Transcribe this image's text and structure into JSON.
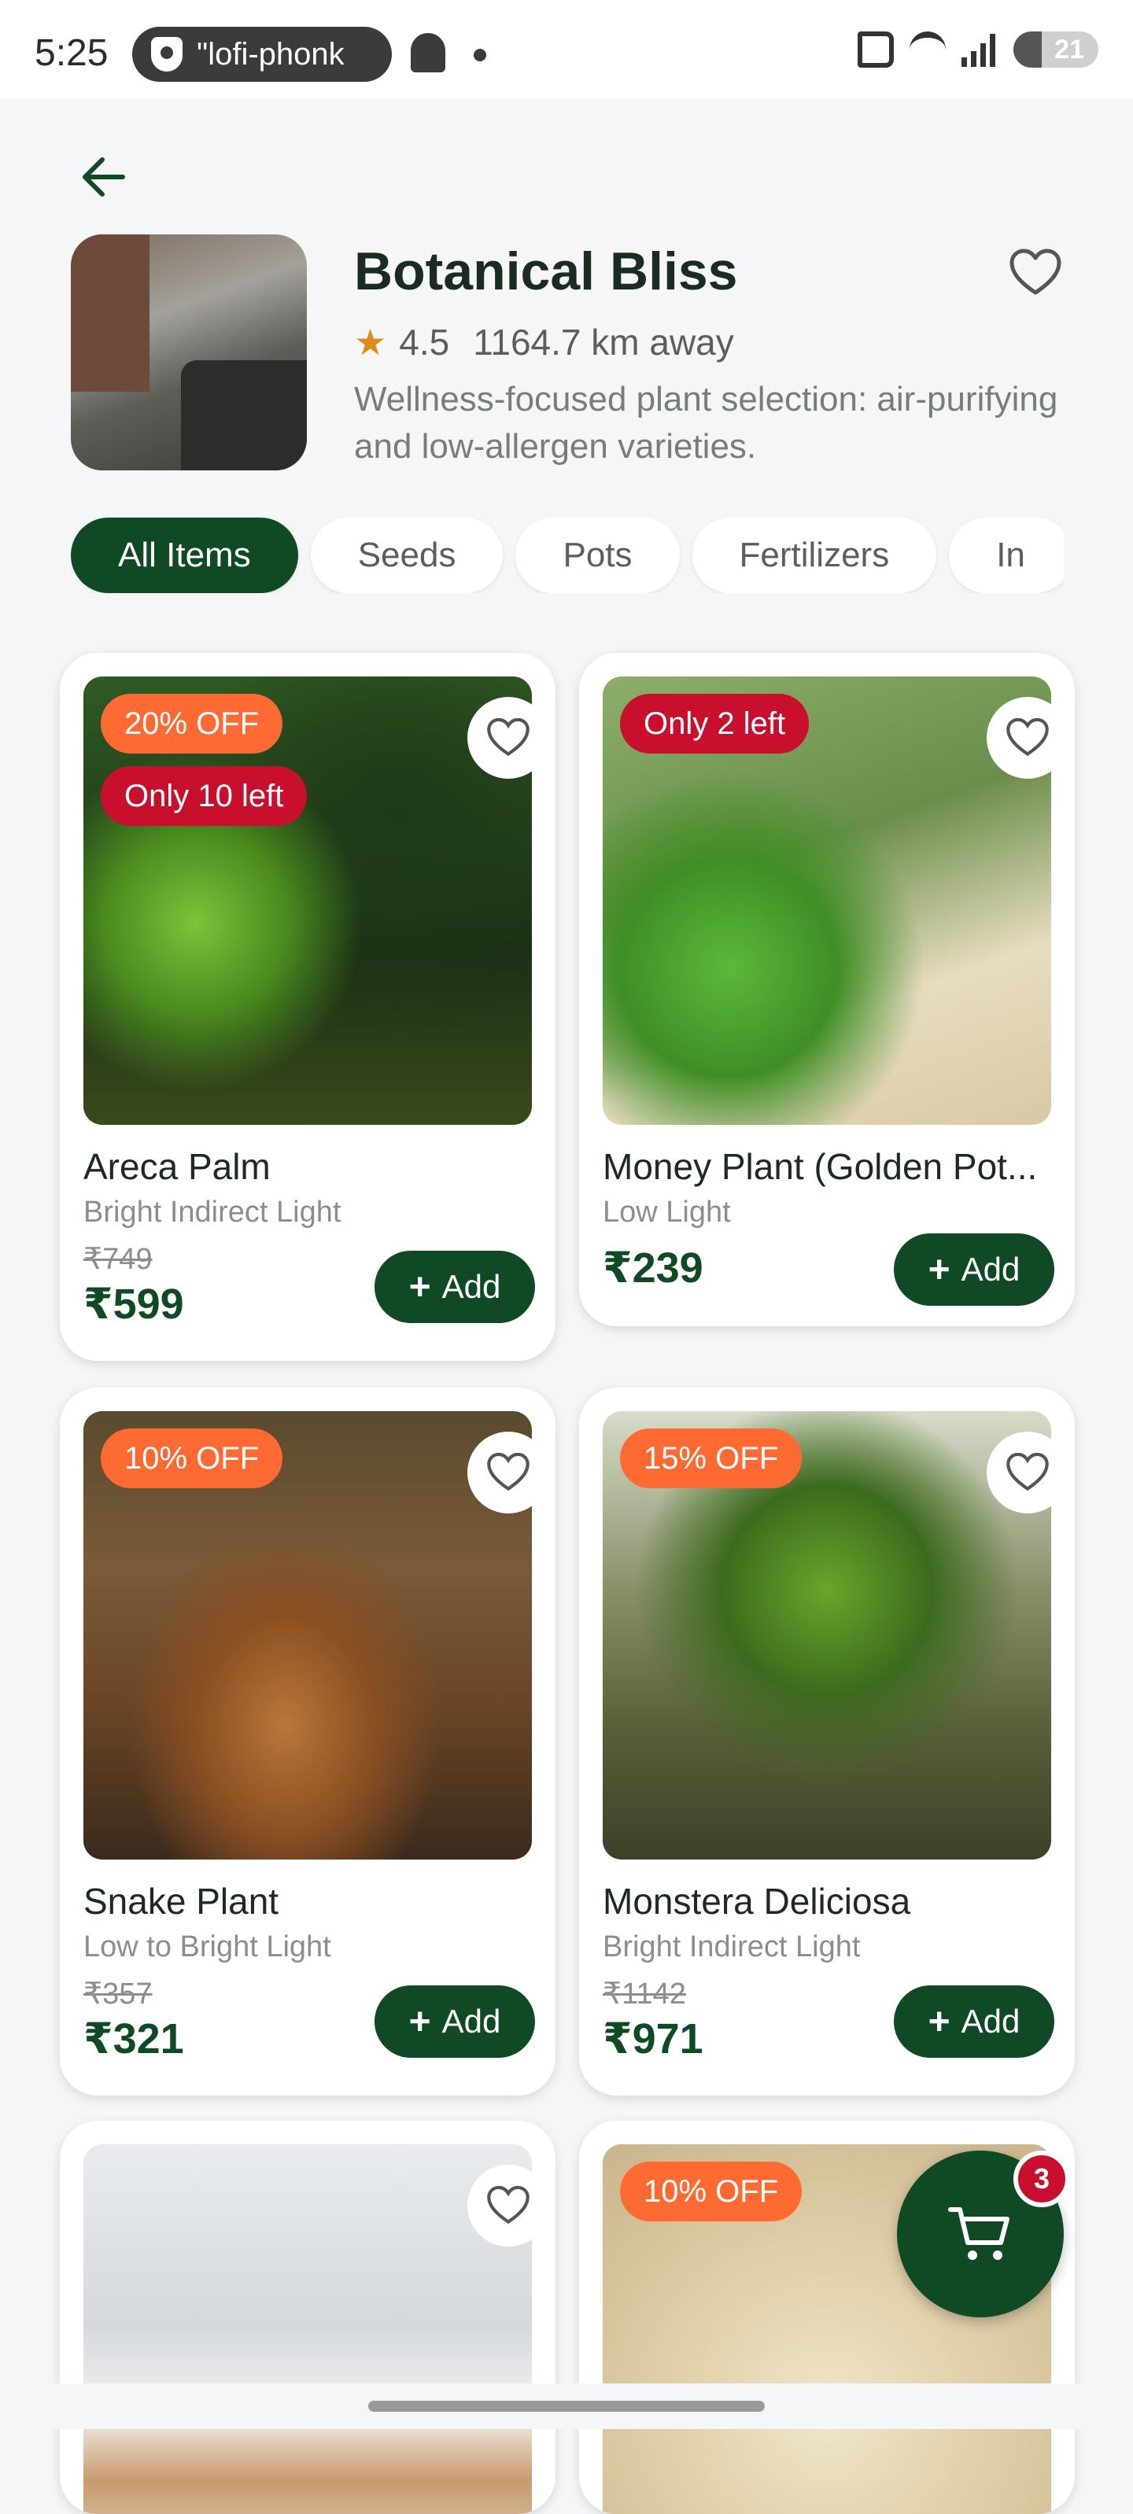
{
  "status_bar": {
    "time": "5:25",
    "media_pill": "\"lofi-phonk",
    "battery": "21"
  },
  "header": {
    "back_icon": "arrow-left-icon",
    "store_name": "Botanical Bliss",
    "rating": "4.5",
    "distance": "1164.7 km away",
    "description": "Wellness-focused plant selection: air-purifying and low-allergen varieties.",
    "favorite_icon": "heart-outline-icon"
  },
  "categories": [
    "All Items",
    "Seeds",
    "Pots",
    "Fertilizers",
    "In"
  ],
  "products": [
    {
      "name": "Areca Palm",
      "light": "Bright Indirect Light",
      "original_price": "₹749",
      "price": "₹599",
      "discount": "20% OFF",
      "stock": "Only 10 left",
      "add_label": "Add"
    },
    {
      "name": "Money Plant (Golden Pot...",
      "light": "Low Light",
      "original_price": "",
      "price": "₹239",
      "discount": "",
      "stock": "Only 2 left",
      "add_label": "Add"
    },
    {
      "name": "Snake Plant",
      "light": "Low to Bright Light",
      "original_price": "₹357",
      "price": "₹321",
      "discount": "10% OFF",
      "stock": "",
      "add_label": "Add"
    },
    {
      "name": "Monstera Deliciosa",
      "light": "Bright Indirect Light",
      "original_price": "₹1142",
      "price": "₹971",
      "discount": "15% OFF",
      "stock": "",
      "add_label": "Add"
    },
    {
      "discount": ""
    },
    {
      "discount": "10% OFF"
    }
  ],
  "cart": {
    "count": "3",
    "icon": "cart-icon"
  },
  "colors": {
    "primary": "#0f4a24",
    "discount": "#ff6a33",
    "stock": "#c8102e",
    "star": "#e08a1a"
  }
}
